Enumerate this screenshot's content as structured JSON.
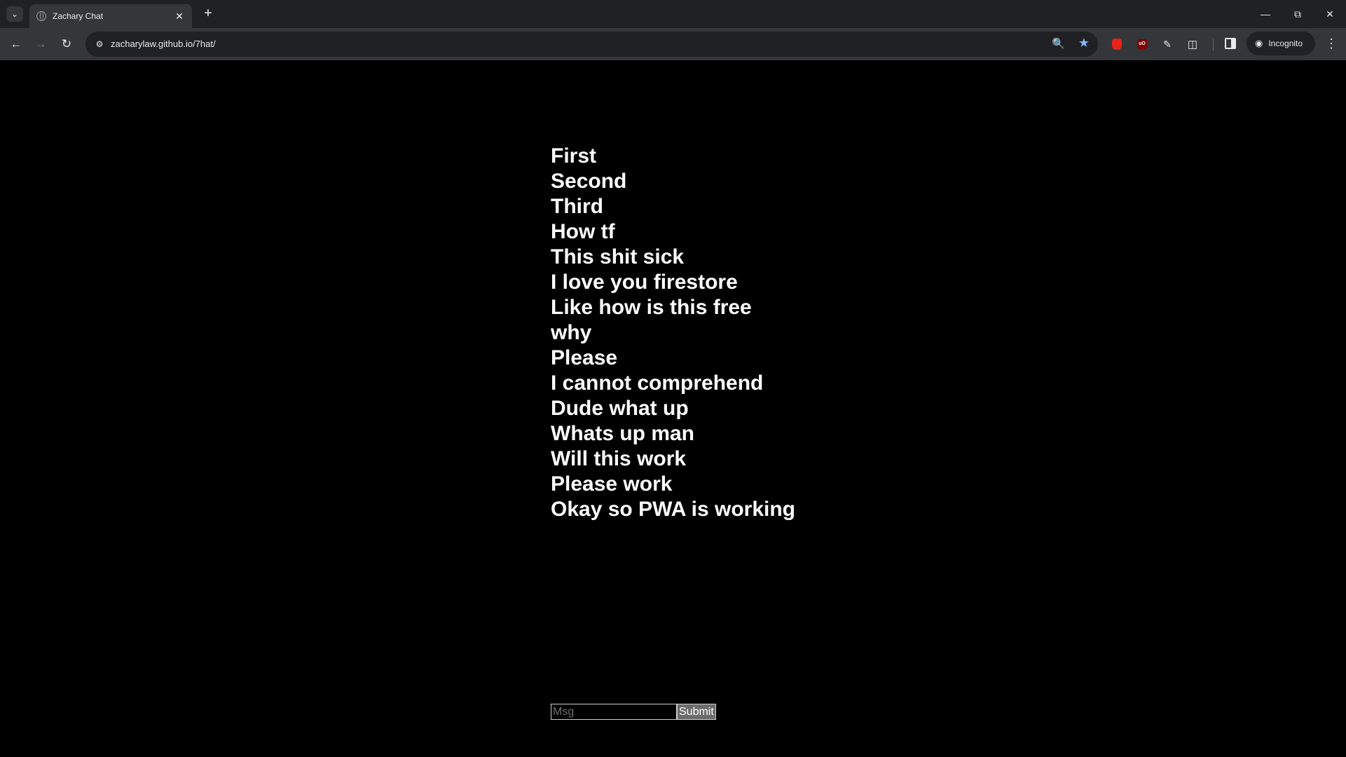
{
  "browser": {
    "tab_title": "Zachary Chat",
    "url": "zacharylaw.github.io/7hat/",
    "profile_label": "Incognito",
    "icons": {
      "tab_search": "chevron-down-icon",
      "favicon": "globe-icon",
      "close": "close-icon",
      "new_tab": "plus-icon",
      "minimize": "minimize-icon",
      "restore": "restore-icon",
      "window_close": "close-icon",
      "back": "arrow-left-icon",
      "forward": "arrow-right-icon",
      "reload": "reload-icon",
      "site_info": "tune-icon",
      "zoom": "zoom-icon",
      "bookmark": "star-icon",
      "extensions": "puzzle-icon",
      "side_panel": "side-panel-icon",
      "incognito": "incognito-icon",
      "menu": "kebab-menu-icon"
    },
    "colors": {
      "frame": "#202124",
      "toolbar": "#35363a",
      "bookmark_star": "#8ab4f8"
    }
  },
  "chat": {
    "messages": [
      "First",
      "Second",
      "Third",
      "How tf",
      "This shit sick",
      "I love you firestore",
      "Like how is this free",
      "why",
      "Please",
      "I cannot comprehend",
      "Dude what up",
      "Whats up man",
      "Will this work",
      "Please work",
      "Okay so PWA is working"
    ],
    "input_placeholder": "Msg",
    "input_value": "",
    "submit_label": "Submit"
  }
}
